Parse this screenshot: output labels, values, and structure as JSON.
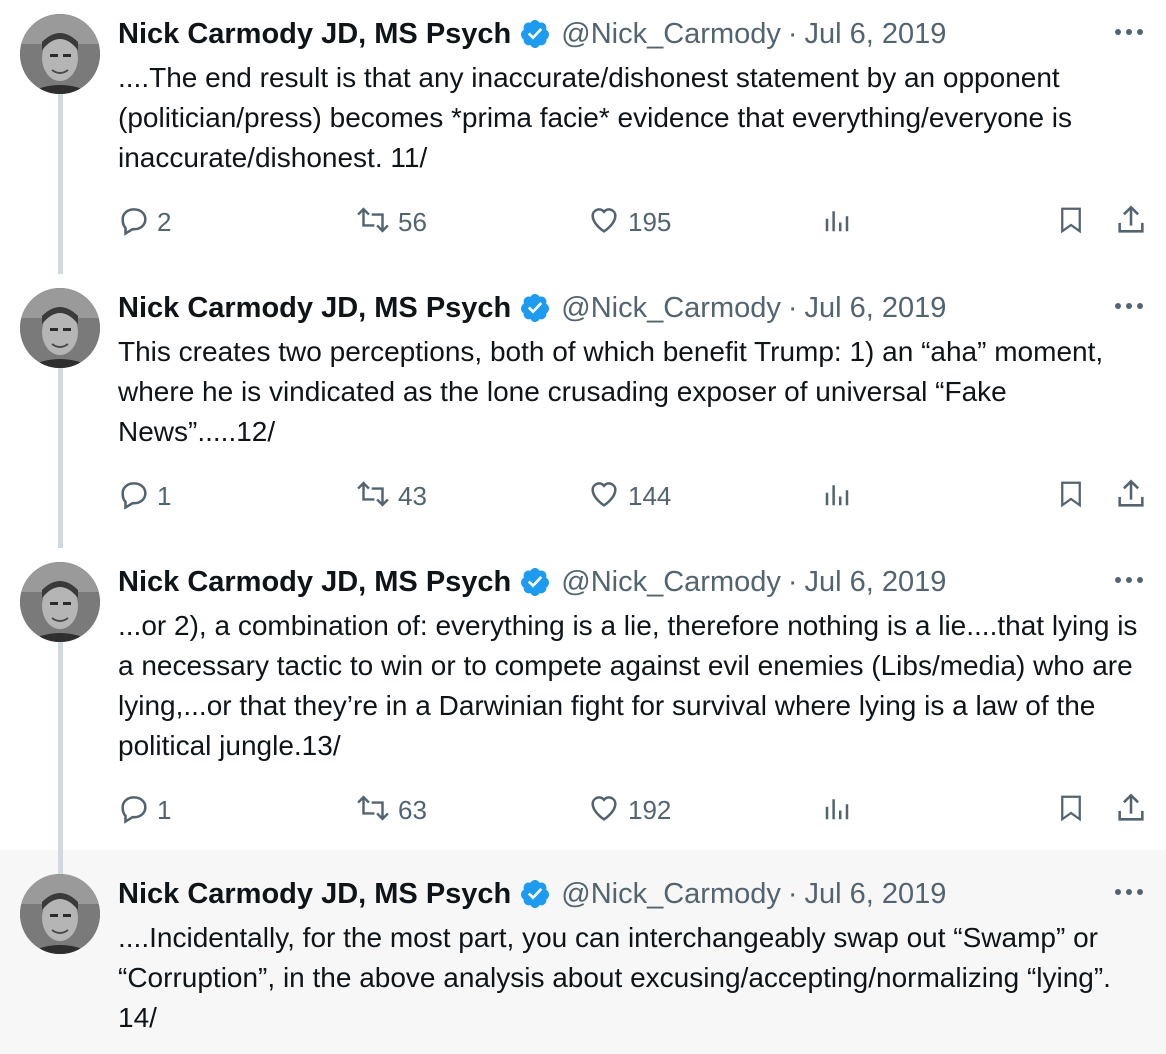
{
  "tweets": [
    {
      "author": "Nick Carmody JD, MS Psych",
      "handle": "@Nick_Carmody",
      "separator": "·",
      "date": "Jul 6, 2019",
      "text": "....The end result is that any inaccurate/dishonest statement by an opponent (politician/press) becomes *prima facie* evidence that everything/everyone is inaccurate/dishonest. 11/",
      "replies": "2",
      "retweets": "56",
      "likes": "195"
    },
    {
      "author": "Nick Carmody JD, MS Psych",
      "handle": "@Nick_Carmody",
      "separator": "·",
      "date": "Jul 6, 2019",
      "text": "This creates two perceptions, both of which benefit Trump: 1) an “aha” moment, where he is vindicated as the lone crusading exposer of universal “Fake News”.....12/",
      "replies": "1",
      "retweets": "43",
      "likes": "144"
    },
    {
      "author": "Nick Carmody JD, MS Psych",
      "handle": "@Nick_Carmody",
      "separator": "·",
      "date": "Jul 6, 2019",
      "text": "...or 2), a combination of: everything is a lie, therefore nothing is a lie....that lying is a necessary tactic to win or to compete against evil enemies (Libs/media) who are lying,...or that they’re in a Darwinian fight for survival where lying is a law of the political jungle.13/",
      "replies": "1",
      "retweets": "63",
      "likes": "192"
    },
    {
      "author": "Nick Carmody JD, MS Psych",
      "handle": "@Nick_Carmody",
      "separator": "·",
      "date": "Jul 6, 2019",
      "text": "....Incidentally, for the most part, you can interchangeably swap out “Swamp” or “Corruption”, in the above analysis about excusing/accepting/normalizing “lying”. 14/"
    }
  ],
  "colors": {
    "text_primary": "#0f1419",
    "text_secondary": "#536471",
    "verified_blue": "#1d9bf0",
    "thread_line": "#cfd9de",
    "highlight_bg": "#f7f7f7"
  },
  "icons": {
    "verified": "verified-badge-icon",
    "more": "more-horizontal-icon",
    "reply": "reply-icon",
    "retweet": "retweet-icon",
    "like": "heart-icon",
    "views": "views-chart-icon",
    "bookmark": "bookmark-icon",
    "share": "share-icon"
  }
}
